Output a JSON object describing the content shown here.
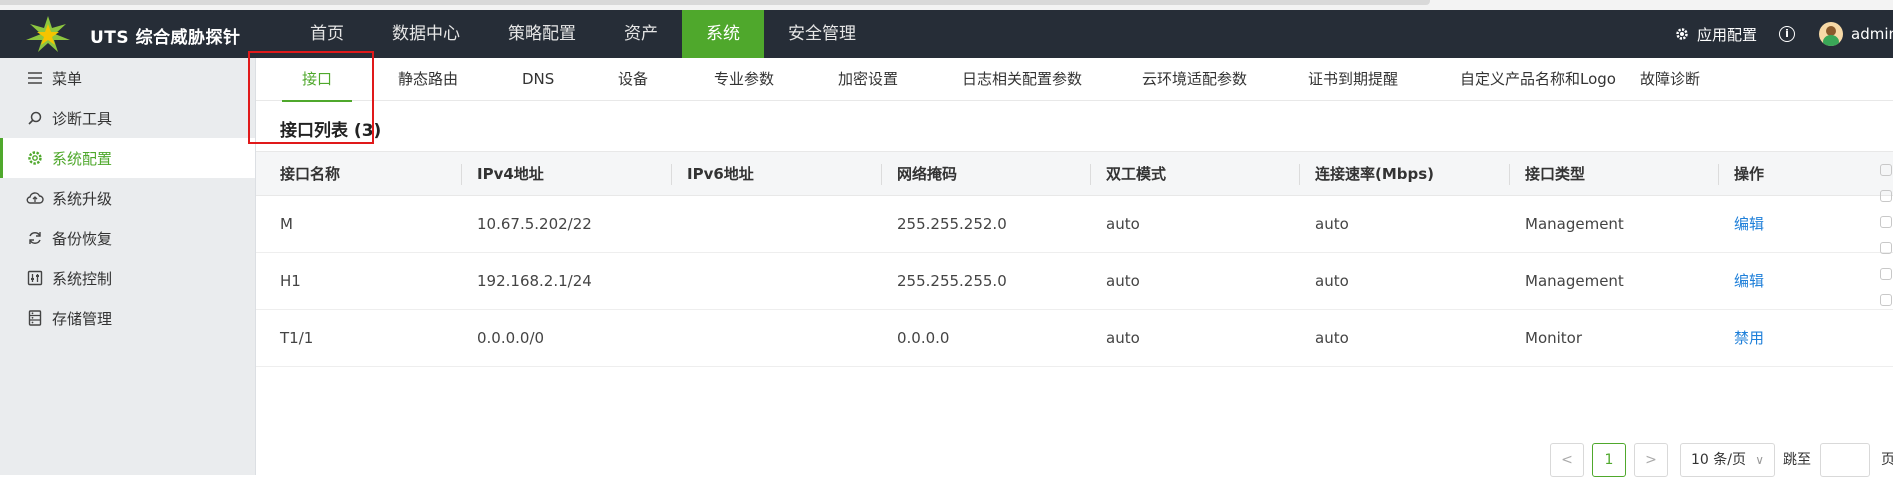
{
  "app": {
    "title": "UTS 综合威胁探针"
  },
  "nav": {
    "items": [
      "首页",
      "数据中心",
      "策略配置",
      "资产",
      "系统",
      "安全管理"
    ],
    "active_index": 4,
    "app_config": "应用配置",
    "user": "admin"
  },
  "sidebar": {
    "items": [
      {
        "label": "菜单",
        "icon": "menu-icon"
      },
      {
        "label": "诊断工具",
        "icon": "search-icon"
      },
      {
        "label": "系统配置",
        "icon": "gear-icon"
      },
      {
        "label": "系统升级",
        "icon": "cloud-upload-icon"
      },
      {
        "label": "备份恢复",
        "icon": "refresh-icon"
      },
      {
        "label": "系统控制",
        "icon": "control-icon"
      },
      {
        "label": "存储管理",
        "icon": "storage-icon"
      }
    ],
    "active_index": 2
  },
  "tabs": {
    "items": [
      "接口",
      "静态路由",
      "DNS",
      "设备",
      "专业参数",
      "加密设置",
      "日志相关配置参数",
      "云环境适配参数",
      "证书到期提醒",
      "自定义产品名称和Logo",
      "故障诊断"
    ],
    "active_index": 0
  },
  "section": {
    "title": "接口列表 (3)"
  },
  "table": {
    "headers": [
      "接口名称",
      "IPv4地址",
      "IPv6地址",
      "网络掩码",
      "双工模式",
      "连接速率(Mbps)",
      "接口类型",
      "操作"
    ],
    "rows": [
      [
        "M",
        "10.67.5.202/22",
        "",
        "255.255.252.0",
        "auto",
        "auto",
        "Management",
        "编辑"
      ],
      [
        "H1",
        "192.168.2.1/24",
        "",
        "255.255.255.0",
        "auto",
        "auto",
        "Management",
        "编辑"
      ],
      [
        "T1/1",
        "0.0.0.0/0",
        "",
        "0.0.0.0",
        "auto",
        "auto",
        "Monitor",
        "禁用"
      ]
    ]
  },
  "pagination": {
    "prev": "<",
    "current": "1",
    "next": ">",
    "page_size": "10 条/页",
    "jump_label": "跳至",
    "page_suffix": "页"
  },
  "colors": {
    "accent": "#4fa82c",
    "navbar": "#262d37",
    "link": "#1e7fd9",
    "highlight_box": "#e0191a"
  }
}
